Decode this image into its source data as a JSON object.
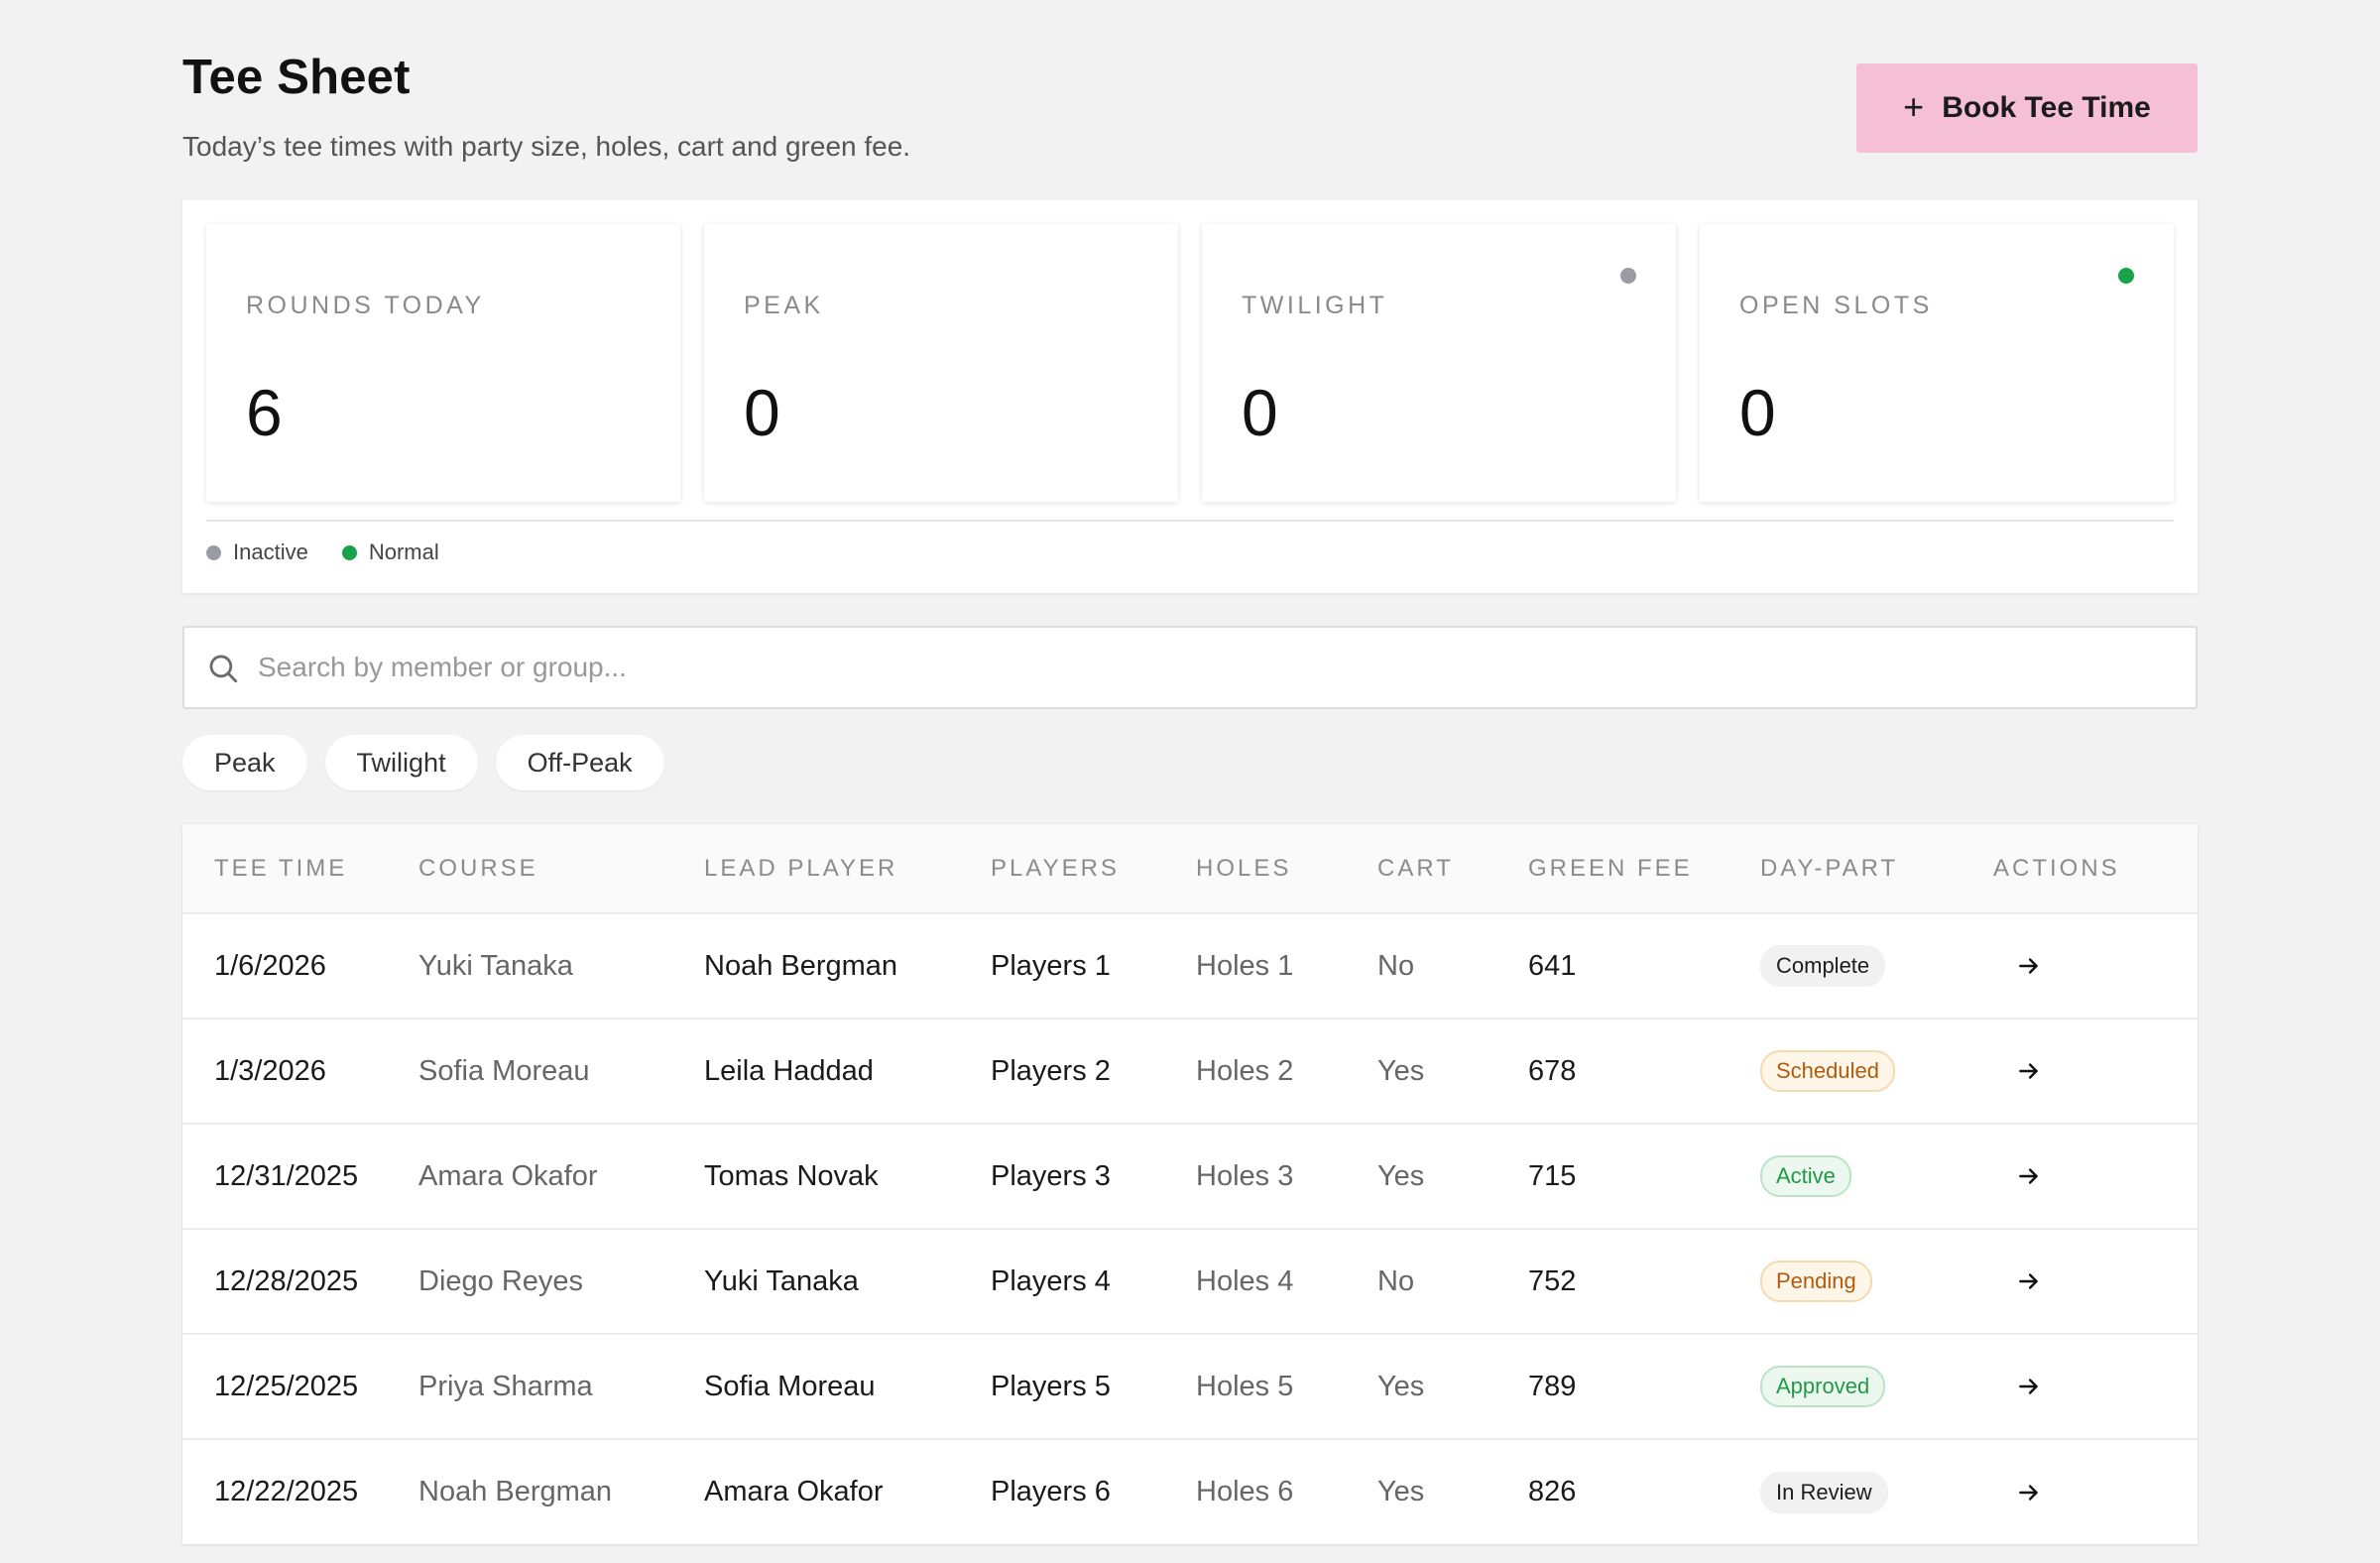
{
  "header": {
    "title": "Tee Sheet",
    "subtitle": "Today’s tee times with party size, holes, cart and green fee.",
    "book_button_label": "Book Tee Time"
  },
  "stats": [
    {
      "label": "ROUNDS TODAY",
      "value": "6",
      "dot": null
    },
    {
      "label": "PEAK",
      "value": "0",
      "dot": null
    },
    {
      "label": "TWILIGHT",
      "value": "0",
      "dot": "#9a9ca3"
    },
    {
      "label": "OPEN SLOTS",
      "value": "0",
      "dot": "#16a34a"
    }
  ],
  "legend": [
    {
      "label": "Inactive",
      "color": "#9a9ca3"
    },
    {
      "label": "Normal",
      "color": "#16a34a"
    }
  ],
  "search": {
    "placeholder": "Search by member or group..."
  },
  "filters": [
    "Peak",
    "Twilight",
    "Off-Peak"
  ],
  "table": {
    "columns": [
      "TEE TIME",
      "COURSE",
      "LEAD PLAYER",
      "PLAYERS",
      "HOLES",
      "CART",
      "GREEN FEE",
      "DAY-PART",
      "ACTIONS"
    ],
    "rows": [
      {
        "tee_time": "1/6/2026",
        "course": "Yuki Tanaka",
        "lead": "Noah Bergman",
        "players": "Players 1",
        "holes": "Holes 1",
        "cart": "No",
        "fee": "641",
        "daypart": "Complete",
        "tone": "gray"
      },
      {
        "tee_time": "1/3/2026",
        "course": "Sofia Moreau",
        "lead": "Leila Haddad",
        "players": "Players 2",
        "holes": "Holes 2",
        "cart": "Yes",
        "fee": "678",
        "daypart": "Scheduled",
        "tone": "orange"
      },
      {
        "tee_time": "12/31/2025",
        "course": "Amara Okafor",
        "lead": "Tomas Novak",
        "players": "Players 3",
        "holes": "Holes 3",
        "cart": "Yes",
        "fee": "715",
        "daypart": "Active",
        "tone": "green"
      },
      {
        "tee_time": "12/28/2025",
        "course": "Diego Reyes",
        "lead": "Yuki Tanaka",
        "players": "Players 4",
        "holes": "Holes 4",
        "cart": "No",
        "fee": "752",
        "daypart": "Pending",
        "tone": "orange"
      },
      {
        "tee_time": "12/25/2025",
        "course": "Priya Sharma",
        "lead": "Sofia Moreau",
        "players": "Players 5",
        "holes": "Holes 5",
        "cart": "Yes",
        "fee": "789",
        "daypart": "Approved",
        "tone": "green"
      },
      {
        "tee_time": "12/22/2025",
        "course": "Noah Bergman",
        "lead": "Amara Okafor",
        "players": "Players 6",
        "holes": "Holes 6",
        "cart": "Yes",
        "fee": "826",
        "daypart": "In Review",
        "tone": "gray"
      }
    ]
  },
  "colors": {
    "accent_button": "#f5c0d6",
    "background": "#f2f2f2"
  }
}
